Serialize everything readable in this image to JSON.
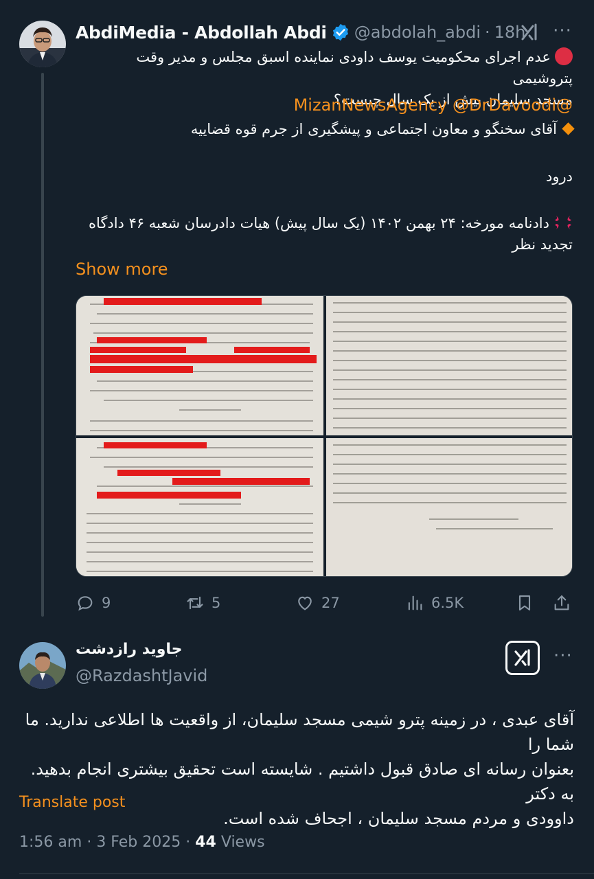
{
  "theme": {
    "background": "#15202b",
    "text": "#f7f9f9",
    "muted": "#8b98a5",
    "accent": "#f4901e",
    "verified": "#1d9bf0",
    "redaction": "#e31b1b"
  },
  "post": {
    "author_name": "AbdiMedia - Abdollah Abdi",
    "handle": "@abdolah_abdi",
    "separator": "·",
    "age": "18h",
    "verified_icon": "verified-badge-icon",
    "lines": [
      "عدم اجرای محکومیت یوسف داودی نماینده اسبق مجلس و مدیر وقت پتروشیمی",
      "مسجد سلیمان بیش از یک سال چیست؟"
    ],
    "mentions": "@MizanNewsAgency @DrDavoodi",
    "addressee": "آقای سخنگو و معاون اجتماعی و پیشگیری از جرم قوه قضاییه",
    "greeting": "درود",
    "verdict_lines": [
      "دادنامه مورخه: ۲۴ بهمن ۱۴۰۲ (یک سال پیش) هیات دادرسان شعبه ۴۶ دادگاه",
      "تجدید نظر"
    ],
    "show_more": "Show more",
    "media_icon_names": [
      "court-document-page-1",
      "court-document-page-2",
      "court-document-page-3",
      "court-document-page-4"
    ],
    "actions": {
      "replies": "9",
      "reposts": "5",
      "likes": "27",
      "views": "6.5K"
    }
  },
  "reply": {
    "author_name": "جاوید رازدشت",
    "handle": "@RazdashtJavid",
    "text_lines": [
      "آقای عبدی ، در زمینه پترو شیمی مسجد سلیمان، از واقعیت ها اطلاعی ندارید. ما شما را",
      "بعنوان  رسانه ای صادق قبول داشتیم . شایسته است تحقیق بیشتری انجام بدهید. به دکتر",
      "داوودی و مردم مسجد سلیمان ، اجحاف شده است."
    ],
    "translate": "Translate post",
    "time": "1:56 am",
    "sep1": "·",
    "date": "3 Feb 2025",
    "sep2": "·",
    "views_count": "44",
    "views_label": "Views"
  }
}
